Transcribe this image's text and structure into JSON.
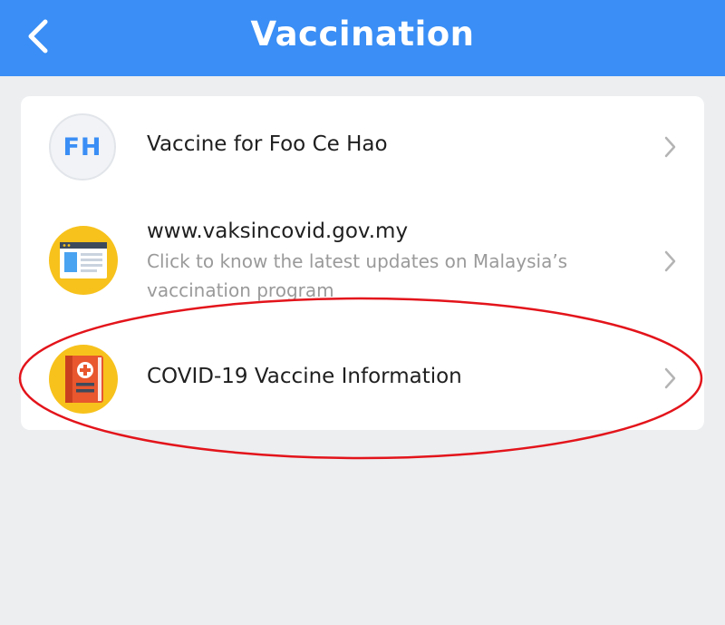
{
  "header": {
    "title": "Vaccination",
    "back_icon": "chevron-left-icon",
    "background": "#3a8ef5"
  },
  "list": {
    "items": [
      {
        "avatar_initials": "FH",
        "title": "Vaccine for Foo Ce Hao",
        "icon": "avatar-initials"
      },
      {
        "title": "www.vaksincovid.gov.my",
        "subtitle": "Click to know the latest updates on Malaysia’s vaccination program",
        "icon": "webpage-icon"
      },
      {
        "title": "COVID-19 Vaccine Information",
        "icon": "medical-book-icon"
      }
    ]
  },
  "annotation": {
    "shape": "red-ellipse",
    "color": "#e3141b",
    "target": "COVID-19 Vaccine Information"
  }
}
